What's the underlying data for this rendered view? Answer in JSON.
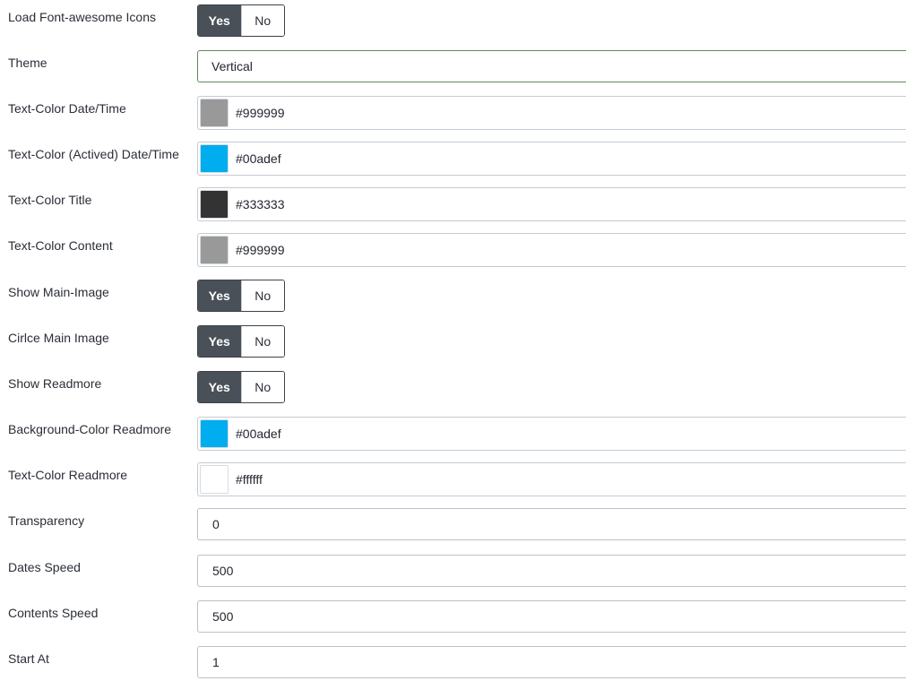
{
  "rows": [
    {
      "label": "Load Font-awesome Icons",
      "type": "toggle",
      "yes": "Yes",
      "no": "No",
      "selected": "Yes"
    },
    {
      "label": "Theme",
      "type": "select",
      "value": "Vertical"
    },
    {
      "label": "Text-Color Date/Time",
      "type": "color",
      "value": "#999999",
      "swatch": "#999999"
    },
    {
      "label": "Text-Color (Actived) Date/Time",
      "type": "color",
      "value": "#00adef",
      "swatch": "#00adef"
    },
    {
      "label": "Text-Color Title",
      "type": "color",
      "value": "#333333",
      "swatch": "#333333"
    },
    {
      "label": "Text-Color Content",
      "type": "color",
      "value": "#999999",
      "swatch": "#999999"
    },
    {
      "label": "Show Main-Image",
      "type": "toggle",
      "yes": "Yes",
      "no": "No",
      "selected": "Yes"
    },
    {
      "label": "Cirlce Main Image",
      "type": "toggle",
      "yes": "Yes",
      "no": "No",
      "selected": "Yes"
    },
    {
      "label": "Show Readmore",
      "type": "toggle",
      "yes": "Yes",
      "no": "No",
      "selected": "Yes"
    },
    {
      "label": "Background-Color Readmore",
      "type": "color",
      "value": "#00adef",
      "swatch": "#00adef"
    },
    {
      "label": "Text-Color Readmore",
      "type": "color",
      "value": "#ffffff",
      "swatch": "#ffffff"
    },
    {
      "label": "Transparency",
      "type": "text",
      "value": "0"
    },
    {
      "label": "Dates Speed",
      "type": "text",
      "value": "500"
    },
    {
      "label": "Contents Speed",
      "type": "text",
      "value": "500"
    },
    {
      "label": "Start At",
      "type": "text",
      "value": "1"
    }
  ]
}
